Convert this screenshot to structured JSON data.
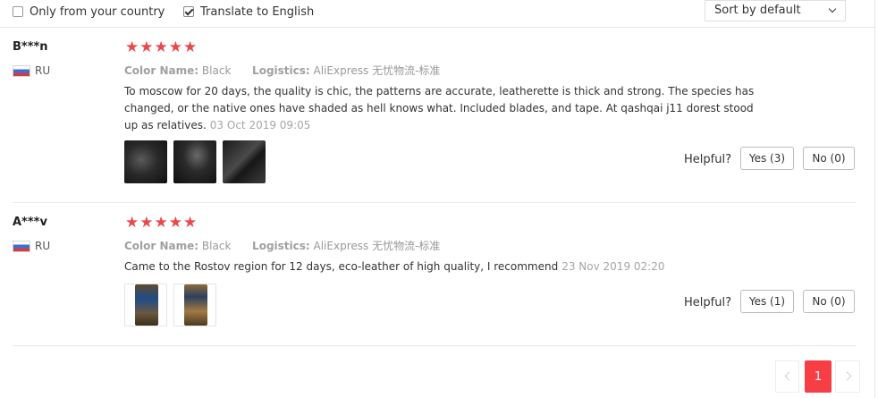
{
  "filters": {
    "only_country_label": "Only from your country",
    "only_country_checked": false,
    "translate_label": "Translate to English",
    "translate_checked": true,
    "sort_value": "Sort by default"
  },
  "reviews": [
    {
      "user": "B***n",
      "country_code": "RU",
      "rating": 5,
      "color_label": "Color Name:",
      "color_value": "Black",
      "logistics_label": "Logistics:",
      "logistics_value": "AliExpress 无忧物流-标准",
      "text": "To moscow for 20 days, the quality is chic, the patterns are accurate, leatherette is thick and strong. The species has changed, or the native ones have shaded as hell knows what. Included blades, and tape. At qashqai j11 dorest stood up as relatives.",
      "date": "03 Oct 2019 09:05",
      "photos": 3,
      "helpful_label": "Helpful?",
      "yes_label": "Yes (3)",
      "no_label": "No (0)"
    },
    {
      "user": "A***v",
      "country_code": "RU",
      "rating": 5,
      "color_label": "Color Name:",
      "color_value": "Black",
      "logistics_label": "Logistics:",
      "logistics_value": "AliExpress 无忧物流-标准",
      "text": "Came to the Rostov region for 12 days, eco-leather of high quality, I recommend",
      "date": "23 Nov 2019 02:20",
      "photos": 2,
      "helpful_label": "Helpful?",
      "yes_label": "Yes (1)",
      "no_label": "No (0)"
    }
  ],
  "pagination": {
    "current_page": "1"
  },
  "icons": {
    "star": "star-icon",
    "flag": "flag-ru-icon",
    "sort_chevron": "chevron-down-icon",
    "prev": "chevron-left-icon",
    "next": "chevron-right-icon"
  },
  "colors": {
    "star": "#e8494c",
    "active_page": "#f73e45",
    "muted_text": "#999999"
  }
}
